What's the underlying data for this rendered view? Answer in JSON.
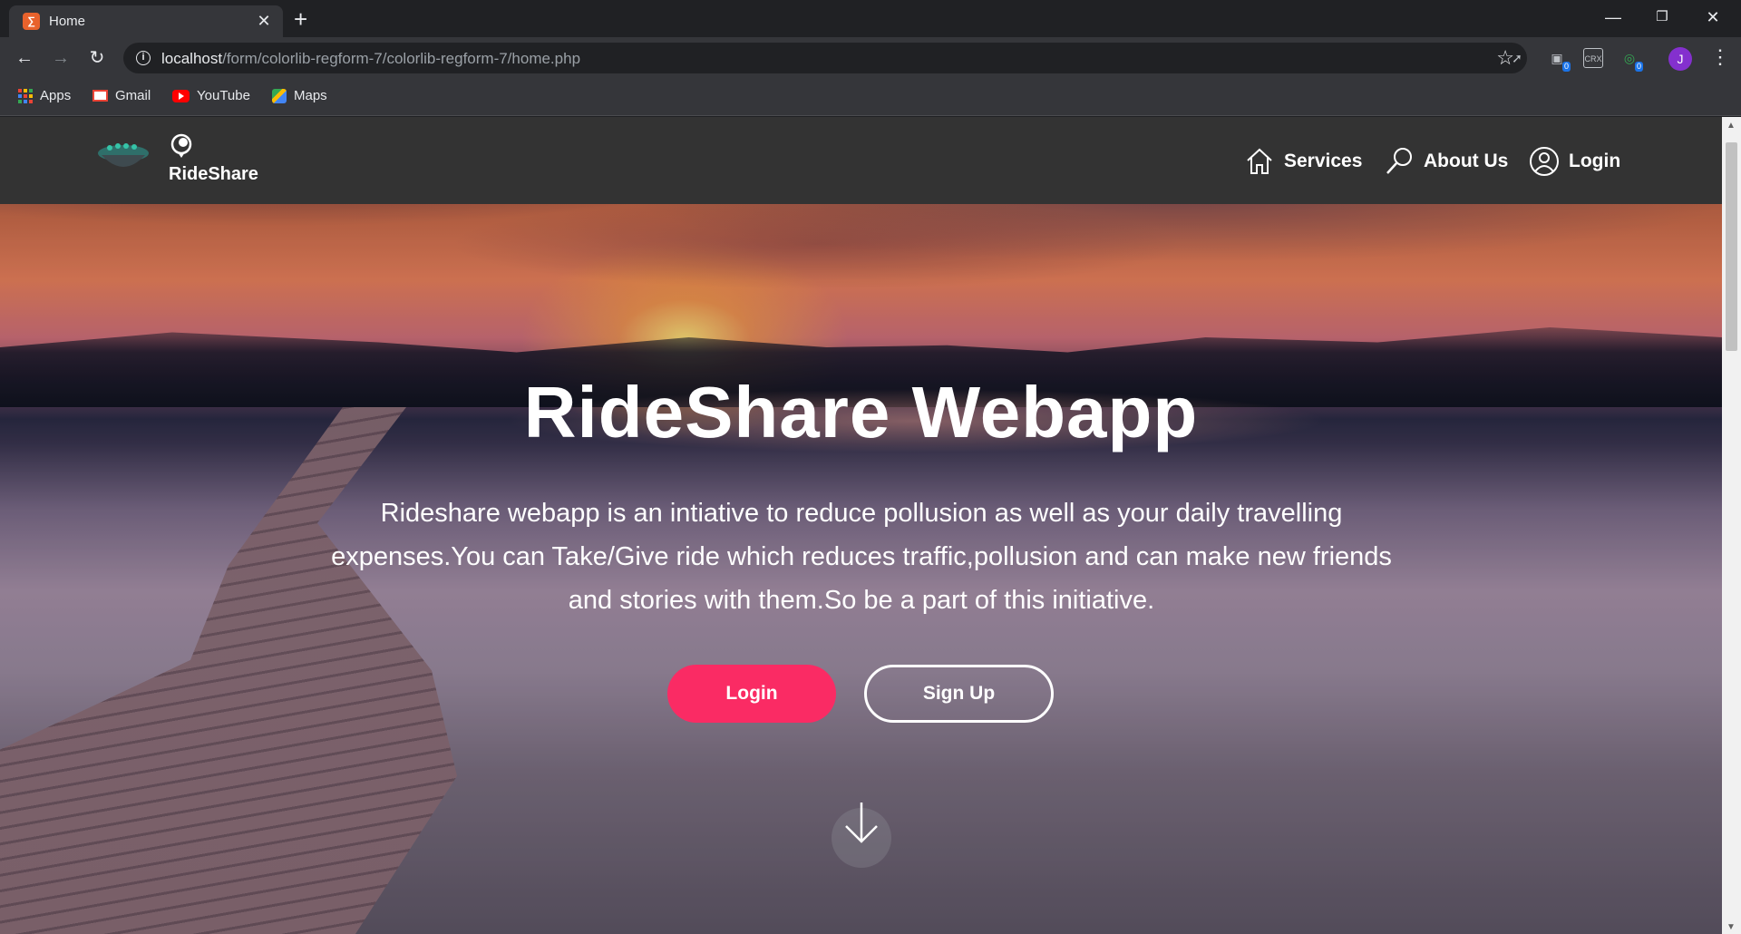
{
  "browser": {
    "tab_title": "Home",
    "tab_favicon": "xampp-icon",
    "url_host": "localhost",
    "url_path": "/form/colorlib-regform-7/colorlib-regform-7/home.php",
    "profile_initial": "J",
    "extension_badge_1": "0",
    "extension_badge_2": "0",
    "extension_crx": "CRX",
    "bookmarks": [
      {
        "label": "Apps",
        "icon": "apps-icon"
      },
      {
        "label": "Gmail",
        "icon": "gmail-icon"
      },
      {
        "label": "YouTube",
        "icon": "youtube-icon"
      },
      {
        "label": "Maps",
        "icon": "maps-icon"
      }
    ]
  },
  "site": {
    "brand": "RideShare",
    "nav": [
      {
        "label": "Services",
        "icon": "home-icon"
      },
      {
        "label": "About Us",
        "icon": "search-icon"
      },
      {
        "label": "Login",
        "icon": "user-icon"
      }
    ],
    "hero": {
      "title": "RideShare Webapp",
      "description": "Rideshare webapp is an intiative to reduce pollusion as well as your daily travelling expenses.You can Take/Give ride which reduces traffic,pollusion and can make new friends and stories with them.So be a part of this initiative.",
      "login_button": "Login",
      "signup_button": "Sign Up"
    },
    "colors": {
      "header_bg": "#333333",
      "primary_button": "#fa2b64",
      "text": "#ffffff"
    }
  }
}
